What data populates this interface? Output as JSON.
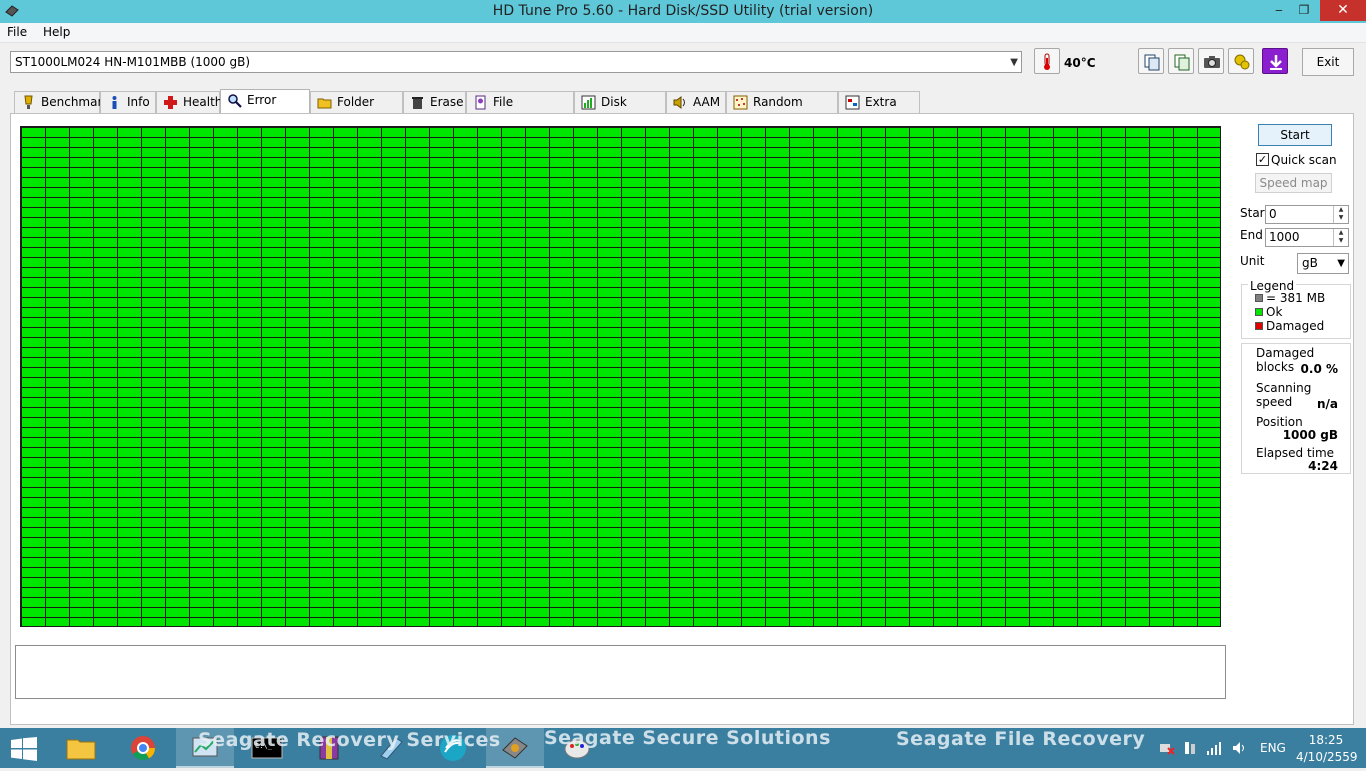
{
  "window": {
    "title": "HD Tune Pro 5.60 - Hard Disk/SSD Utility (trial version)",
    "minimize": "‒",
    "maximize": "❐",
    "close": "✕"
  },
  "menu": {
    "file": "File",
    "help": "Help"
  },
  "toolbar": {
    "drive": "ST1000LM024 HN-M101MBB (1000 gB)",
    "temperature": "40°C",
    "exit_label": "Exit"
  },
  "tabs": [
    {
      "label": "Benchmark",
      "icon": "benchmark-icon"
    },
    {
      "label": "Info",
      "icon": "info-icon"
    },
    {
      "label": "Health",
      "icon": "health-icon"
    },
    {
      "label": "Error Scan",
      "icon": "error-scan-icon",
      "active": true
    },
    {
      "label": "Folder Usage",
      "icon": "folder-usage-icon"
    },
    {
      "label": "Erase",
      "icon": "erase-icon"
    },
    {
      "label": "File Benchmark",
      "icon": "file-benchmark-icon"
    },
    {
      "label": "Disk monitor",
      "icon": "disk-monitor-icon"
    },
    {
      "label": "AAM",
      "icon": "aam-icon"
    },
    {
      "label": "Random Access",
      "icon": "random-access-icon"
    },
    {
      "label": "Extra tests",
      "icon": "extra-tests-icon"
    }
  ],
  "controls": {
    "start_label": "Start",
    "quick_scan_label": "Quick scan",
    "quick_scan_checked": "✓",
    "speed_map_label": "Speed map",
    "start_field_label": "Start",
    "start_value": "0",
    "end_field_label": "End",
    "end_value": "1000",
    "unit_label": "Unit",
    "unit_value": "gB"
  },
  "legend": {
    "title": "Legend",
    "block_size": "= 381 MB",
    "ok": "Ok",
    "damaged": "Damaged",
    "colors": {
      "block": "#808080",
      "ok": "#00e600",
      "damaged": "#e00000"
    }
  },
  "stats": {
    "damaged_blocks_label": "Damaged blocks",
    "damaged_blocks_value": "0.0 %",
    "scanning_speed_label": "Scanning speed",
    "scanning_speed_value": "n/a",
    "position_label": "Position",
    "position_value": "1000 gB",
    "elapsed_label": "Elapsed time",
    "elapsed_value": "4:24"
  },
  "scan_grid": {
    "status": "ok",
    "color": "#00e600"
  },
  "taskbar": {
    "overlay_1": "Seagate Recovery Services",
    "overlay_2": "Seagate Secure Solutions",
    "overlay_3": "Seagate File Recovery",
    "language": "ENG",
    "time": "18:25",
    "date": "4/10/2559"
  }
}
